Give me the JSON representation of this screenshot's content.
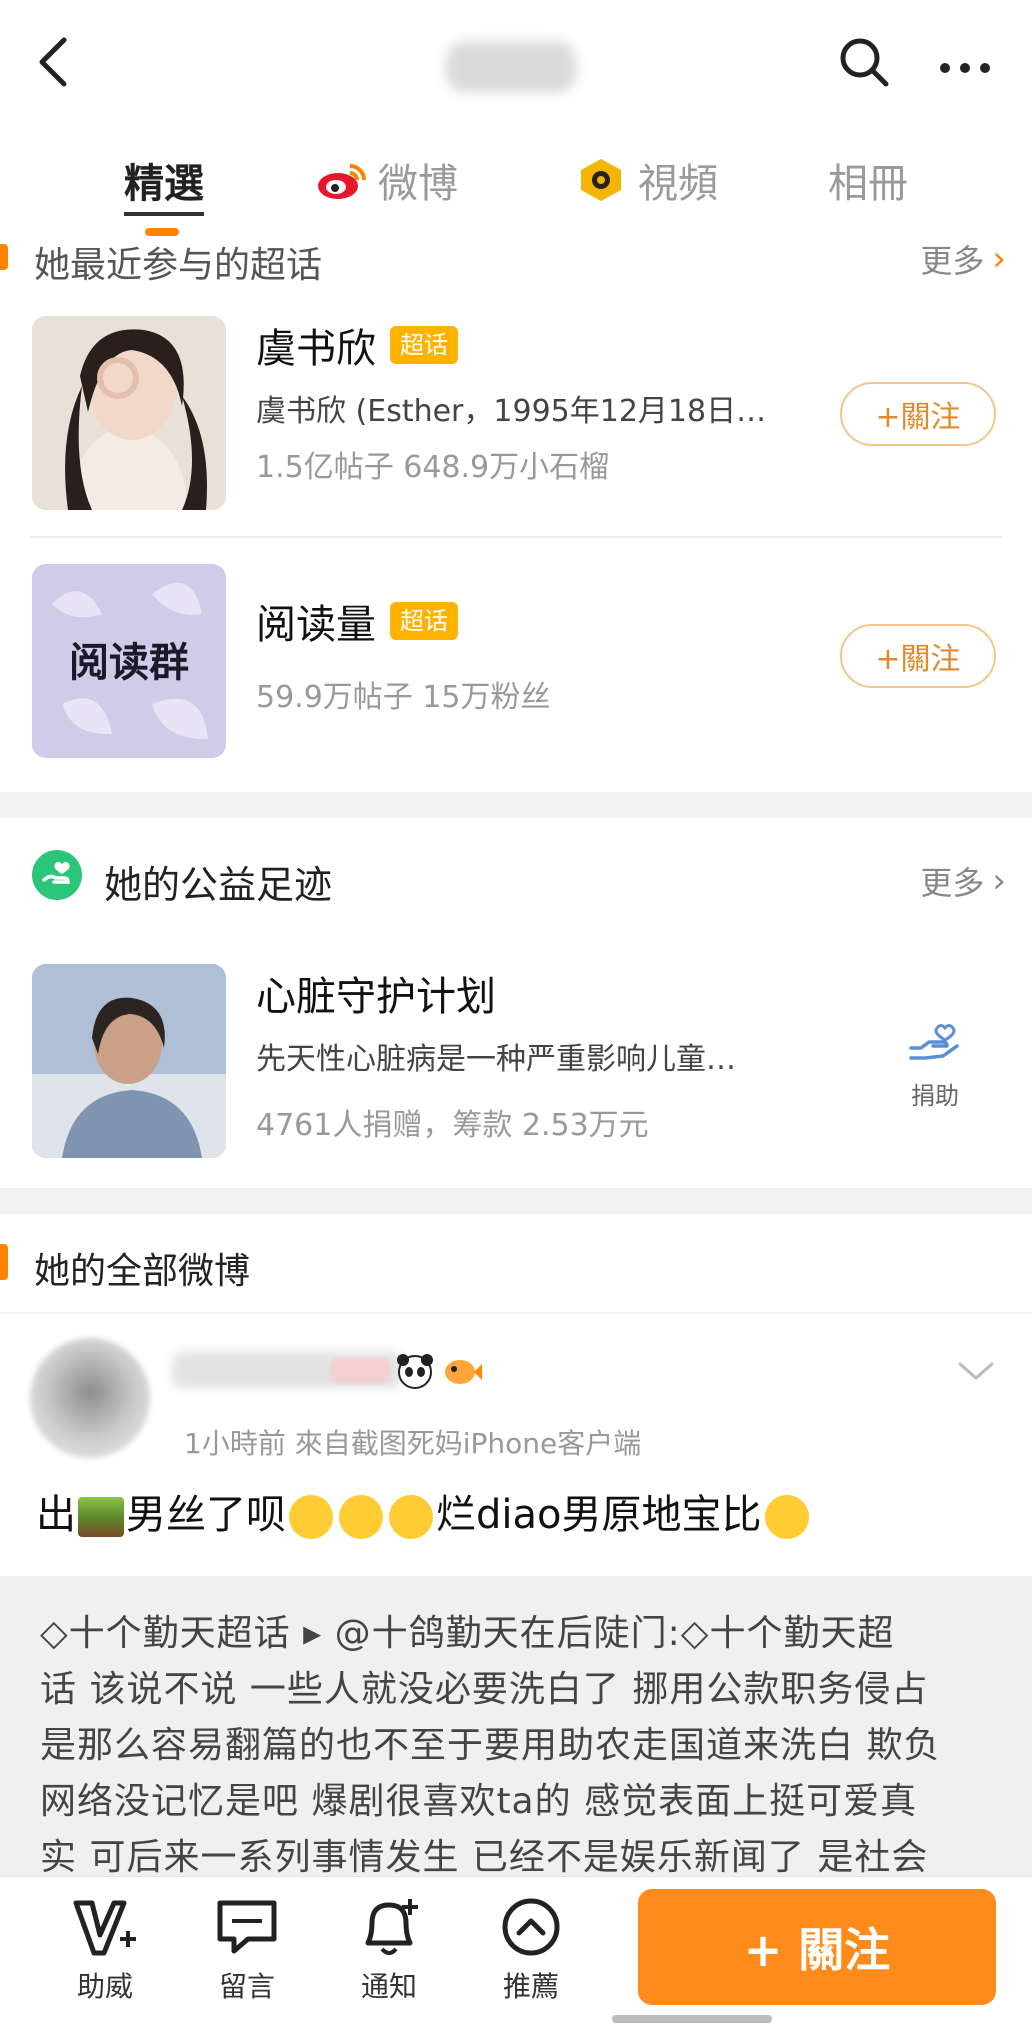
{
  "nav": {
    "tabs": [
      {
        "label": "精選"
      },
      {
        "label": "微博"
      },
      {
        "label": "視頻"
      },
      {
        "label": "相冊"
      }
    ]
  },
  "supertopics": {
    "heading": "她最近参与的超话",
    "more": "更多",
    "items": [
      {
        "name": "虞书欣",
        "badge": "超话",
        "desc": "虞书欣 (Esther，1995年12月18日…",
        "meta": "1.5亿帖子 648.9万小石榴",
        "follow": "+關注"
      },
      {
        "name": "阅读量",
        "badge": "超话",
        "thumb_text": "阅读群",
        "meta": "59.9万帖子 15万粉丝",
        "follow": "+關注"
      }
    ]
  },
  "charity": {
    "heading": "她的公益足迹",
    "more": "更多",
    "item": {
      "title": "心脏守护计划",
      "desc": "先天性心脏病是一种严重影响儿童…",
      "meta": "4761人捐赠，筹款 2.53万元",
      "donate": "捐助"
    }
  },
  "posts": {
    "heading": "她的全部微博",
    "post": {
      "time_source": "1小時前  來自截图死妈iPhone客户端",
      "text_parts": [
        "出",
        "男丝了呗",
        "烂diao男原地宝比"
      ],
      "repost_lines": [
        "◇十个勤天超话 ▸ @十鸽勤天在后陡门:◇十个勤天超",
        "话  该说不说 一些人就没必要洗白了 挪用公款职务侵占",
        "是那么容易翻篇的也不至于要用助农走国道来洗白 欺负",
        "网络没记忆是吧 爆剧很喜欢ta的 感觉表面上挺可爱真",
        "实 可后来一系列事情发生 已经不是娱乐新闻了 是社会"
      ]
    }
  },
  "bottom": {
    "items": [
      {
        "label": "助威"
      },
      {
        "label": "留言"
      },
      {
        "label": "通知"
      },
      {
        "label": "推薦"
      }
    ],
    "follow": "+ 關注"
  },
  "colors": {
    "accent": "#ff8200",
    "badge": "#ffb300",
    "follow_border": "#f5c58a"
  }
}
